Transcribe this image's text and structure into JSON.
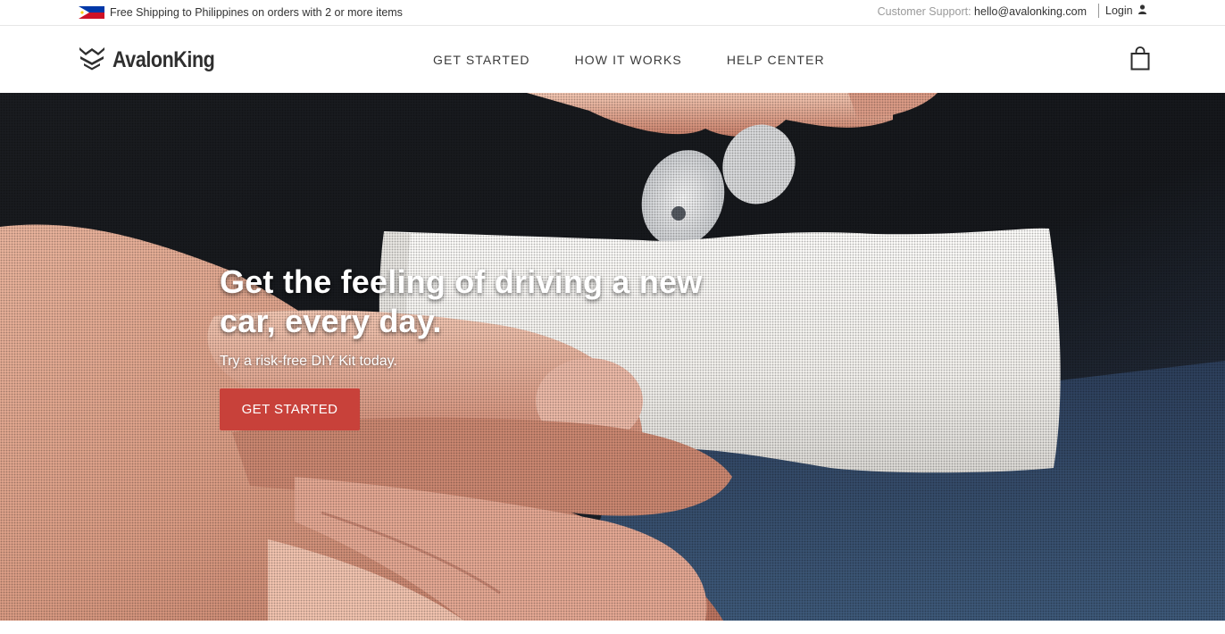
{
  "topbar": {
    "flag_icon": "philippines-flag-icon",
    "shipping_text": "Free Shipping to Philippines on orders with 2 or more items",
    "support_label": "Customer Support:",
    "support_email": "hello@avalonking.com",
    "login_label": "Login",
    "login_icon": "user-icon"
  },
  "header": {
    "logo_text": "AvalonKing",
    "logo_icon": "shield-crown-logo-icon",
    "nav": [
      {
        "label": "GET STARTED"
      },
      {
        "label": "HOW IT WORKS"
      },
      {
        "label": "HELP CENTER"
      }
    ],
    "cart_icon": "shopping-bag-icon"
  },
  "hero": {
    "title": "Get the feeling of driving a new car, every day.",
    "subtitle": "Try a risk-free DIY Kit today.",
    "cta_label": "GET STARTED"
  },
  "colors": {
    "accent": "#c8413a",
    "text": "#333333",
    "muted": "#9a9a9a"
  }
}
